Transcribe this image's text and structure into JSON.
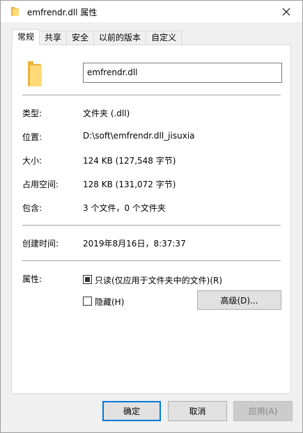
{
  "window": {
    "title": "emfrendr.dll 属性",
    "close_symbol": "✕"
  },
  "tabs": [
    {
      "label": "常规",
      "active": true
    },
    {
      "label": "共享",
      "active": false
    },
    {
      "label": "安全",
      "active": false
    },
    {
      "label": "以前的版本",
      "active": false
    },
    {
      "label": "自定义",
      "active": false
    }
  ],
  "general": {
    "file_name": "emfrendr.dll",
    "rows": {
      "type": {
        "label": "类型:",
        "value": "文件夹 (.dll)"
      },
      "location": {
        "label": "位置:",
        "value": "D:\\soft\\emfrendr.dll_jisuxia"
      },
      "size": {
        "label": "大小:",
        "value": "124 KB (127,548 字节)"
      },
      "size_on_disk": {
        "label": "占用空间:",
        "value": "128 KB (131,072 字节)"
      },
      "contains": {
        "label": "包含:",
        "value": "3 个文件，0 个文件夹"
      },
      "created": {
        "label": "创建时间:",
        "value": "2019年8月16日，8:37:37"
      }
    },
    "attributes": {
      "label": "属性:",
      "readonly_label": "只读(仅应用于文件夹中的文件)(R)",
      "readonly_state": "indeterminate",
      "hidden_label": "隐藏(H)",
      "hidden_checked": false,
      "advanced_label": "高级(D)..."
    }
  },
  "footer": {
    "ok_label": "确定",
    "cancel_label": "取消",
    "apply_label": "应用(A)"
  },
  "colors": {
    "folder_light": "#ffd977",
    "folder_dark": "#e8b53a",
    "accent": "#0078d7"
  }
}
